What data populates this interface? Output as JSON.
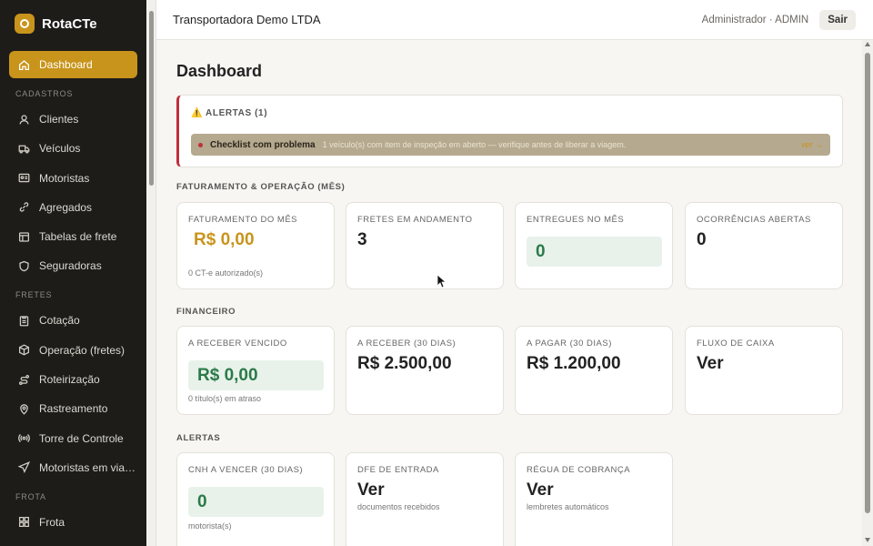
{
  "brand": {
    "name": "RotaCTe"
  },
  "colors": {
    "accent": "#c8941b",
    "sidebar": "#1e1c19",
    "success": "#2a7a4a",
    "danger": "#c0303b"
  },
  "sidebar": {
    "active": {
      "label": "Dashboard",
      "icon": "home-icon"
    },
    "sections": [
      {
        "label": "CADASTROS",
        "items": [
          {
            "label": "Clientes",
            "icon": "user-icon"
          },
          {
            "label": "Veículos",
            "icon": "truck-icon"
          },
          {
            "label": "Motoristas",
            "icon": "id-card-icon"
          },
          {
            "label": "Agregados",
            "icon": "link-icon"
          },
          {
            "label": "Tabelas de frete",
            "icon": "table-icon"
          },
          {
            "label": "Seguradoras",
            "icon": "shield-icon"
          }
        ]
      },
      {
        "label": "FRETES",
        "items": [
          {
            "label": "Cotação",
            "icon": "clipboard-icon"
          },
          {
            "label": "Operação (fretes)",
            "icon": "package-icon"
          },
          {
            "label": "Roteirização",
            "icon": "route-icon"
          },
          {
            "label": "Rastreamento",
            "icon": "map-pin-icon"
          },
          {
            "label": "Torre de Controle",
            "icon": "radio-tower-icon"
          },
          {
            "label": "Motoristas em viag...",
            "icon": "send-icon"
          }
        ]
      },
      {
        "label": "FROTA",
        "items": [
          {
            "label": "Frota",
            "icon": "grid-icon"
          }
        ]
      }
    ]
  },
  "header": {
    "company": "Transportadora Demo LTDA",
    "user": "Administrador · ADMIN",
    "logout_label": "Sair"
  },
  "main": {
    "title": "Dashboard",
    "alerts_box": {
      "title": "⚠️ ALERTAS (1)",
      "item": {
        "title": "Checklist com problema",
        "description": "1 veículo(s) com item de inspeção em aberto — verifique antes de liberar a viagem.",
        "link": "ver →"
      }
    },
    "faturamento": {
      "title": "FATURAMENTO & OPERAÇÃO (MÊS)",
      "cards": [
        {
          "label": "FATURAMENTO DO MÊS",
          "value": "R$ 0,00",
          "sub": "0 CT-e autorizado(s)"
        },
        {
          "label": "FRETES EM ANDAMENTO",
          "value": "3"
        },
        {
          "label": "ENTREGUES NO MÊS",
          "value": "0"
        },
        {
          "label": "OCORRÊNCIAS ABERTAS",
          "value": "0"
        }
      ]
    },
    "financeiro": {
      "title": "FINANCEIRO",
      "cards": [
        {
          "label": "A RECEBER VENCIDO",
          "value": "R$ 0,00",
          "sub": "0 título(s) em atraso"
        },
        {
          "label": "A RECEBER (30 DIAS)",
          "value": "R$ 2.500,00"
        },
        {
          "label": "A PAGAR (30 DIAS)",
          "value": "R$ 1.200,00"
        },
        {
          "label": "FLUXO DE CAIXA",
          "value": "Ver"
        }
      ]
    },
    "alertas": {
      "title": "ALERTAS",
      "cards": [
        {
          "label": "CNH A VENCER (30 DIAS)",
          "value": "0",
          "sub": "motorista(s)"
        },
        {
          "label": "DFE DE ENTRADA",
          "value": "Ver",
          "sub": "documentos recebidos"
        },
        {
          "label": "RÉGUA DE COBRANÇA",
          "value": "Ver",
          "sub": "lembretes automáticos"
        }
      ]
    }
  }
}
